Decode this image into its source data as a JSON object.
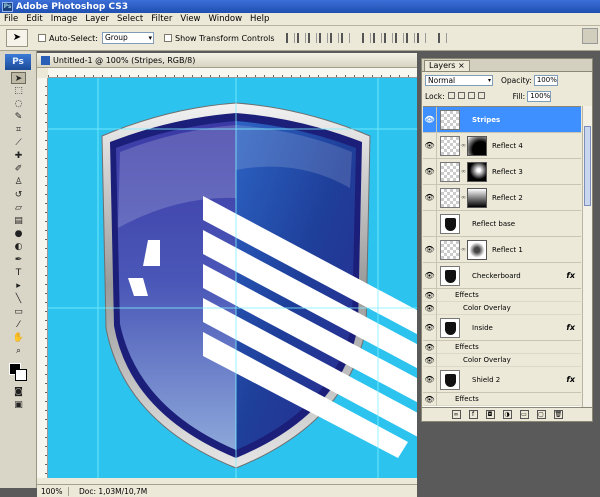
{
  "app": {
    "title": "Adobe Photoshop CS3",
    "logo": "Ps"
  },
  "menu": [
    "File",
    "Edit",
    "Image",
    "Layer",
    "Select",
    "Filter",
    "View",
    "Window",
    "Help"
  ],
  "options": {
    "auto_select_label": "Auto-Select:",
    "auto_select_value": "Group",
    "transform_label": "Show Transform Controls"
  },
  "document": {
    "title": "Untitled-1 @ 100% (Stripes, RGB/8)",
    "zoom": "100%",
    "doc_size": "Doc: 1,03M/10,7M",
    "canvas_color": "#2cc3ef"
  },
  "layers_panel": {
    "tab": "Layers",
    "close": "×",
    "blend_mode": "Normal",
    "opacity_label": "Opacity:",
    "opacity": "100%",
    "lock_label": "Lock:",
    "fill_label": "Fill:",
    "fill": "100%",
    "layers": [
      {
        "name": "Stripes",
        "selected": true
      },
      {
        "name": "Reflect 4"
      },
      {
        "name": "Reflect 3"
      },
      {
        "name": "Reflect 2"
      },
      {
        "name": "Reflect base"
      },
      {
        "name": "Reflect 1"
      },
      {
        "name": "Checkerboard",
        "fx": "fx",
        "effects_label": "Effects",
        "effect": "Color Overlay"
      },
      {
        "name": "Inside",
        "fx": "fx",
        "effects_label": "Effects",
        "effect": "Color Overlay"
      },
      {
        "name": "Shield 2",
        "fx": "fx",
        "effects_label": "Effects"
      }
    ]
  }
}
